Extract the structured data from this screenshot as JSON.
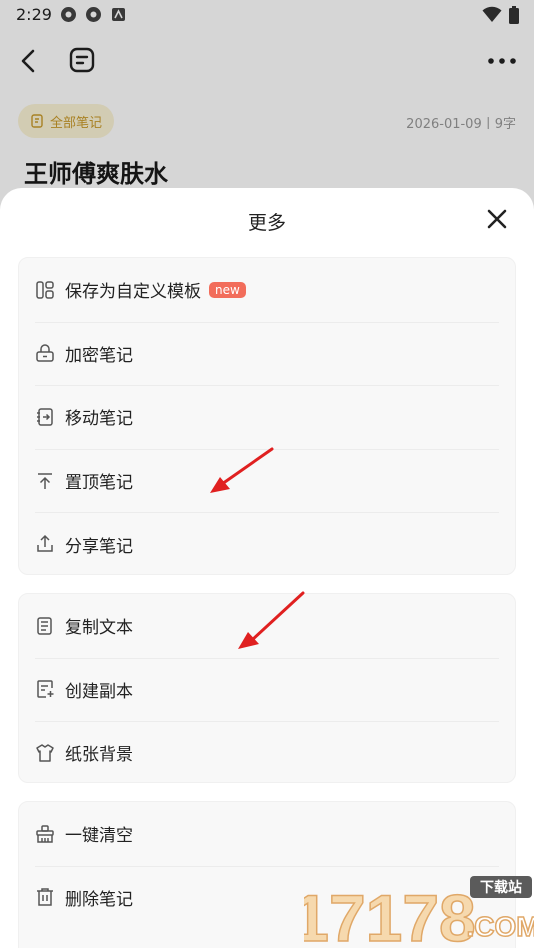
{
  "status_bar": {
    "time": "2:29"
  },
  "note": {
    "tag_label": "全部笔记",
    "meta": "2026-01-09丨9字",
    "title": "王师傅爽肤水"
  },
  "sheet": {
    "title": "更多",
    "groups": [
      [
        {
          "label": "保存为自定义模板",
          "badge": "new",
          "icon": "template-icon"
        },
        {
          "label": "加密笔记",
          "icon": "lock-icon"
        },
        {
          "label": "移动笔记",
          "icon": "move-icon"
        },
        {
          "label": "置顶笔记",
          "icon": "pin-top-icon"
        },
        {
          "label": "分享笔记",
          "icon": "share-icon"
        }
      ],
      [
        {
          "label": "复制文本",
          "icon": "copy-text-icon"
        },
        {
          "label": "创建副本",
          "icon": "duplicate-icon"
        },
        {
          "label": "纸张背景",
          "icon": "paper-background-icon"
        }
      ],
      [
        {
          "label": "一键清空",
          "icon": "clear-icon"
        },
        {
          "label": "删除笔记",
          "icon": "trash-icon"
        }
      ]
    ]
  },
  "watermark": {
    "text": "17178",
    "badge": "下载站",
    "suffix": ".COM"
  },
  "colors": {
    "accent": "#f26d5b",
    "tag_bg": "#fbf3d6",
    "tag_text": "#c99a2a",
    "arrow": "#e02020"
  }
}
